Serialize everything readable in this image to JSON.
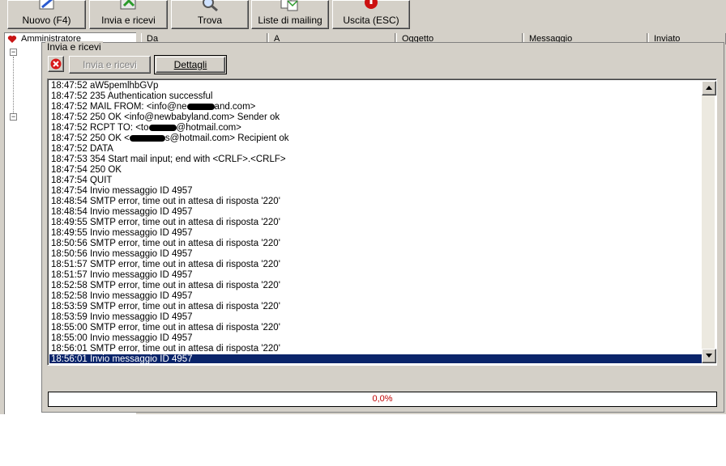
{
  "toolbar": {
    "new_label": "Nuovo (F4)",
    "sendrecv_label": "Invia e ricevi",
    "find_label": "Trova",
    "mailing_label": "Liste di mailing",
    "exit_label": "Uscita (ESC)"
  },
  "tree": {
    "root_label": "Amministratore"
  },
  "list_columns": [
    "Da",
    "A",
    "Oggetto",
    "Messaggio",
    "Inviato"
  ],
  "dialog": {
    "title": "Invia e ricevi",
    "send_button": "Invia e ricevi",
    "details_button": "Dettagli",
    "progress_text": "0,0%"
  },
  "log": [
    {
      "time": "18:47:52",
      "pre": "aW5pemlhbGVp",
      "post": ""
    },
    {
      "time": "18:47:52",
      "pre": "235 Authentication successful",
      "post": ""
    },
    {
      "time": "18:47:52",
      "pre": "MAIL FROM: <info@ne",
      "post": "and.com>"
    },
    {
      "time": "18:47:52",
      "pre": "250 OK <info@newbabyland.com> Sender ok",
      "post": ""
    },
    {
      "time": "18:47:52",
      "pre": "RCPT TO: <to",
      "post": "@hotmail.com>"
    },
    {
      "time": "18:47:52",
      "pre": "250 OK <",
      "post": "s@hotmail.com> Recipient ok"
    },
    {
      "time": "18:47:52",
      "pre": "DATA",
      "post": ""
    },
    {
      "time": "18:47:53",
      "pre": "354 Start mail input; end with <CRLF>.<CRLF>",
      "post": ""
    },
    {
      "time": "18:47:54",
      "pre": "250 OK",
      "post": ""
    },
    {
      "time": "18:47:54",
      "pre": "QUIT",
      "post": ""
    },
    {
      "time": "18:47:54",
      "pre": "Invio messaggio ID 4957",
      "post": ""
    },
    {
      "time": "18:48:54",
      "pre": "SMTP error, time out in attesa di risposta '220'",
      "post": ""
    },
    {
      "time": "18:48:54",
      "pre": "Invio messaggio ID 4957",
      "post": ""
    },
    {
      "time": "18:49:55",
      "pre": "SMTP error, time out in attesa di risposta '220'",
      "post": ""
    },
    {
      "time": "18:49:55",
      "pre": "Invio messaggio ID 4957",
      "post": ""
    },
    {
      "time": "18:50:56",
      "pre": "SMTP error, time out in attesa di risposta '220'",
      "post": ""
    },
    {
      "time": "18:50:56",
      "pre": "Invio messaggio ID 4957",
      "post": ""
    },
    {
      "time": "18:51:57",
      "pre": "SMTP error, time out in attesa di risposta '220'",
      "post": ""
    },
    {
      "time": "18:51:57",
      "pre": "Invio messaggio ID 4957",
      "post": ""
    },
    {
      "time": "18:52:58",
      "pre": "SMTP error, time out in attesa di risposta '220'",
      "post": ""
    },
    {
      "time": "18:52:58",
      "pre": "Invio messaggio ID 4957",
      "post": ""
    },
    {
      "time": "18:53:59",
      "pre": "SMTP error, time out in attesa di risposta '220'",
      "post": ""
    },
    {
      "time": "18:53:59",
      "pre": "Invio messaggio ID 4957",
      "post": ""
    },
    {
      "time": "18:55:00",
      "pre": "SMTP error, time out in attesa di risposta '220'",
      "post": ""
    },
    {
      "time": "18:55:00",
      "pre": "Invio messaggio ID 4957",
      "post": ""
    },
    {
      "time": "18:56:01",
      "pre": "SMTP error, time out in attesa di risposta '220'",
      "post": ""
    },
    {
      "time": "18:56:01",
      "pre": "Invio messaggio ID 4957",
      "post": "",
      "selected": true
    }
  ],
  "colors": {
    "selection": "#0a246a",
    "progress_text": "#c00000",
    "window_face": "#d4d0c8"
  },
  "icons": [
    "new-message-icon",
    "send-receive-icon",
    "find-icon",
    "mailing-list-icon",
    "exit-icon",
    "close-icon",
    "heart-icon"
  ]
}
